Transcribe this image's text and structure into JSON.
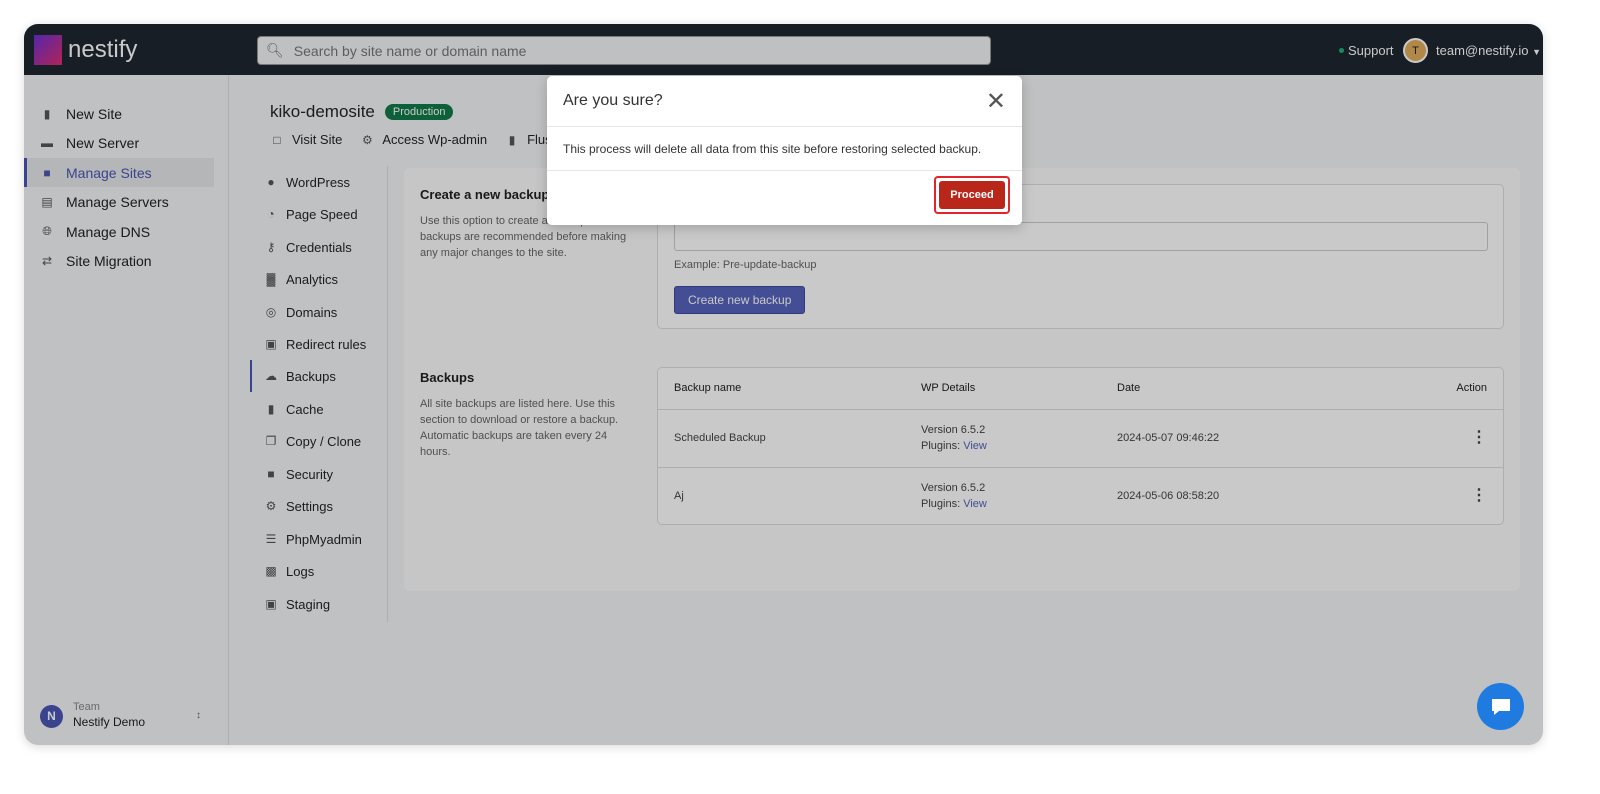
{
  "topbar": {
    "brand": "nestify",
    "search_placeholder": "Search by site name or domain name",
    "support": "Support",
    "avatar_initial": "T",
    "user_email": "team@nestify.io"
  },
  "sidebar": {
    "items": [
      {
        "label": "New Site",
        "icon": "file-plus-icon"
      },
      {
        "label": "New Server",
        "icon": "server-icon"
      },
      {
        "label": "Manage Sites",
        "icon": "folder-icon"
      },
      {
        "label": "Manage Servers",
        "icon": "servers-icon"
      },
      {
        "label": "Manage DNS",
        "icon": "globe-icon"
      },
      {
        "label": "Site Migration",
        "icon": "migration-icon"
      }
    ],
    "active": "Manage Sites",
    "team_label": "Team",
    "team_name": "Nestify Demo",
    "team_initial": "N"
  },
  "site": {
    "name": "kiko-demosite",
    "badge": "Production",
    "actions": [
      "Visit Site",
      "Access Wp-admin",
      "Flush Pa"
    ]
  },
  "submenu": {
    "items": [
      "WordPress",
      "Page Speed",
      "Credentials",
      "Analytics",
      "Domains",
      "Redirect rules",
      "Backups",
      "Cache",
      "Copy / Clone",
      "Security",
      "Settings",
      "PhpMyadmin",
      "Logs",
      "Staging"
    ],
    "active": "Backups"
  },
  "create_backup": {
    "title": "Create a new backup",
    "description": "Use this option to create a backup. Manual backups are recommended before making any major changes to the site.",
    "example": "Example: Pre-update-backup",
    "button": "Create new backup"
  },
  "backups": {
    "title": "Backups",
    "description": "All site backups are listed here. Use this section to download or restore a backup. Automatic backups are taken every 24 hours.",
    "columns": [
      "Backup name",
      "WP Details",
      "Date",
      "Action"
    ],
    "rows": [
      {
        "name": "Scheduled Backup",
        "version": "Version 6.5.2",
        "plugins_label": "Plugins:",
        "plugins_link": "View",
        "date": "2024-05-07 09:46:22"
      },
      {
        "name": "Aj",
        "version": "Version 6.5.2",
        "plugins_label": "Plugins:",
        "plugins_link": "View",
        "date": "2024-05-06 08:58:20"
      }
    ]
  },
  "modal": {
    "title": "Are you sure?",
    "message": "This process will delete all data from this site before restoring selected backup.",
    "proceed": "Proceed"
  },
  "colors": {
    "accent": "#4a56b3",
    "danger": "#b8271a",
    "topbar": "#1f2730",
    "production": "#127a4c"
  }
}
